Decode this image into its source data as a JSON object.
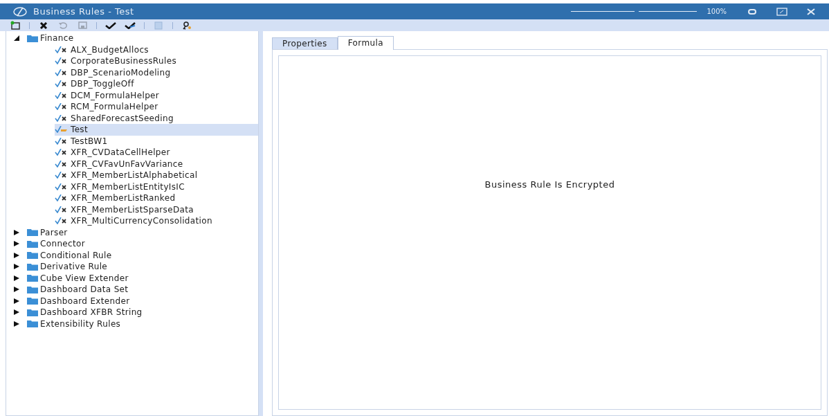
{
  "window": {
    "title": "Business Rules - Test",
    "zoom": {
      "level": 0.52,
      "reading": "100%"
    }
  },
  "toolbar": [
    {
      "kind": "new",
      "disabled": false
    },
    {
      "kind": "sep"
    },
    {
      "kind": "delete",
      "disabled": false
    },
    {
      "kind": "undo",
      "disabled": true
    },
    {
      "kind": "save",
      "disabled": true
    },
    {
      "kind": "sep"
    },
    {
      "kind": "check",
      "disabled": false
    },
    {
      "kind": "checkall",
      "disabled": false
    },
    {
      "kind": "sep"
    },
    {
      "kind": "copy",
      "disabled": true
    },
    {
      "kind": "sep"
    },
    {
      "kind": "key",
      "disabled": false
    }
  ],
  "tree": [
    {
      "label": "Finance",
      "expanded": true,
      "children": [
        {
          "label": "ALX_BudgetAllocs",
          "selected": false
        },
        {
          "label": "CorporateBusinessRules",
          "selected": false
        },
        {
          "label": "DBP_ScenarioModeling",
          "selected": false
        },
        {
          "label": "DBP_ToggleOff",
          "selected": false
        },
        {
          "label": "DCM_FormulaHelper",
          "selected": false
        },
        {
          "label": "RCM_FormulaHelper",
          "selected": false
        },
        {
          "label": "SharedForecastSeeding",
          "selected": false
        },
        {
          "label": "Test",
          "selected": true
        },
        {
          "label": "TestBW1",
          "selected": false
        },
        {
          "label": "XFR_CVDataCellHelper",
          "selected": false
        },
        {
          "label": "XFR_CVFavUnFavVariance",
          "selected": false
        },
        {
          "label": "XFR_MemberListAlphabetical",
          "selected": false
        },
        {
          "label": "XFR_MemberListEntityIsIC",
          "selected": false
        },
        {
          "label": "XFR_MemberListRanked",
          "selected": false
        },
        {
          "label": "XFR_MemberListSparseData",
          "selected": false
        },
        {
          "label": "XFR_MultiCurrencyConsolidation",
          "selected": false
        }
      ]
    },
    {
      "label": "Parser",
      "expanded": false
    },
    {
      "label": "Connector",
      "expanded": false
    },
    {
      "label": "Conditional Rule",
      "expanded": false
    },
    {
      "label": "Derivative Rule",
      "expanded": false
    },
    {
      "label": "Cube View Extender",
      "expanded": false
    },
    {
      "label": "Dashboard Data Set",
      "expanded": false
    },
    {
      "label": "Dashboard Extender",
      "expanded": false
    },
    {
      "label": "Dashboard XFBR String",
      "expanded": false
    },
    {
      "label": "Extensibility Rules",
      "expanded": false
    }
  ],
  "tabs": [
    {
      "label": "Properties",
      "selected": false
    },
    {
      "label": "Formula",
      "selected": true
    }
  ],
  "message": "Business Rule Is Encrypted"
}
